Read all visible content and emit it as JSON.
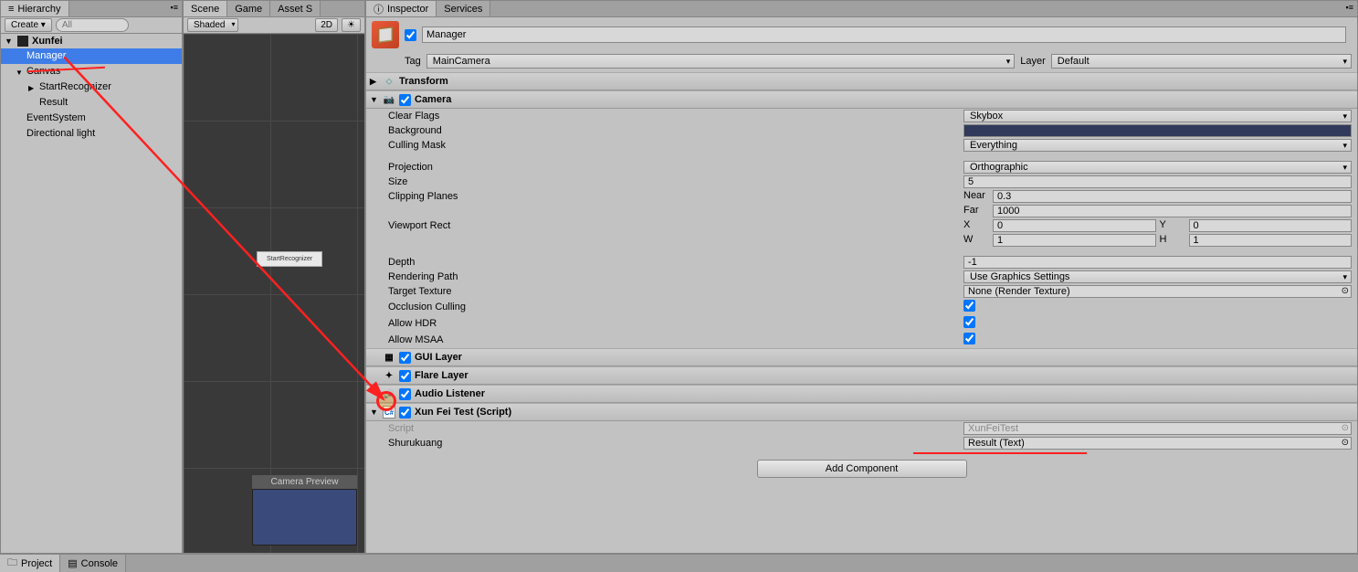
{
  "hierarchy": {
    "tab": "Hierarchy",
    "create": "Create",
    "search_ph": "All",
    "scene": "Xunfei",
    "items": [
      "Manager",
      "Canvas",
      "StartRecognizer",
      "Result",
      "EventSystem",
      "Directional light"
    ]
  },
  "scene": {
    "tabs": [
      "Scene",
      "Game",
      "Asset S"
    ],
    "shading": "Shaded",
    "mode2d": "2D",
    "preview": "Camera Preview",
    "button_in_scene": "StartRecognizer"
  },
  "inspector": {
    "tabs": [
      "Inspector",
      "Services"
    ],
    "name": "Manager",
    "tag_lbl": "Tag",
    "tag": "MainCamera",
    "layer_lbl": "Layer",
    "layer": "Default",
    "transform": "Transform",
    "camera": {
      "title": "Camera",
      "clear_flags_lbl": "Clear Flags",
      "clear_flags": "Skybox",
      "background_lbl": "Background",
      "culling_lbl": "Culling Mask",
      "culling": "Everything",
      "projection_lbl": "Projection",
      "projection": "Orthographic",
      "size_lbl": "Size",
      "size": "5",
      "clip_lbl": "Clipping Planes",
      "near_lbl": "Near",
      "near": "0.3",
      "far_lbl": "Far",
      "far": "1000",
      "viewport_lbl": "Viewport Rect",
      "x_lbl": "X",
      "x": "0",
      "y_lbl": "Y",
      "y": "0",
      "w_lbl": "W",
      "w": "1",
      "h_lbl": "H",
      "h": "1",
      "depth_lbl": "Depth",
      "depth": "-1",
      "rpath_lbl": "Rendering Path",
      "rpath": "Use Graphics Settings",
      "ttex_lbl": "Target Texture",
      "ttex": "None (Render Texture)",
      "occ_lbl": "Occlusion Culling",
      "hdr_lbl": "Allow HDR",
      "msaa_lbl": "Allow MSAA"
    },
    "gui_layer": "GUI Layer",
    "flare_layer": "Flare Layer",
    "audio_listener": "Audio Listener",
    "xft": {
      "title": "Xun Fei Test (Script)",
      "script_lbl": "Script",
      "script": "XunFeiTest",
      "shuru_lbl": "Shurukuang",
      "shuru": "Result (Text)"
    },
    "add_comp": "Add Component"
  },
  "bottom": {
    "project": "Project",
    "console": "Console"
  }
}
